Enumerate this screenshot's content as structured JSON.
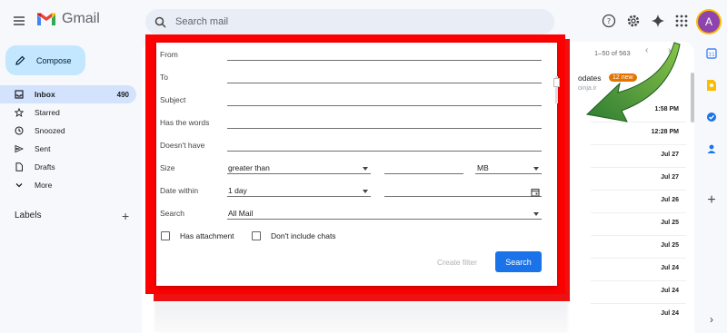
{
  "app": {
    "name": "Gmail"
  },
  "search": {
    "placeholder": "Search mail"
  },
  "sidebar": {
    "compose_label": "Compose",
    "items": [
      {
        "label": "Inbox",
        "count": "490",
        "icon": "inbox-icon"
      },
      {
        "label": "Starred",
        "icon": "star-icon"
      },
      {
        "label": "Snoozed",
        "icon": "clock-icon"
      },
      {
        "label": "Sent",
        "icon": "send-icon"
      },
      {
        "label": "Drafts",
        "icon": "draft-icon"
      },
      {
        "label": "More",
        "icon": "chevron-down-icon"
      }
    ],
    "labels_title": "Labels"
  },
  "header": {
    "avatar_letter": "A"
  },
  "list": {
    "pager": "1–50 of 563",
    "updates_title": "odates",
    "updates_badge": "12 new",
    "updates_sub": "oinja.ir",
    "dates": [
      "1:58 PM",
      "12:28 PM",
      "Jul 27",
      "Jul 27",
      "Jul 26",
      "Jul 25",
      "Jul 25",
      "Jul 24",
      "Jul 24",
      "Jul 24"
    ]
  },
  "filter": {
    "from_label": "From",
    "to_label": "To",
    "subject_label": "Subject",
    "has_words_label": "Has the words",
    "doesnt_have_label": "Doesn't have",
    "size_label": "Size",
    "size_operator": "greater than",
    "size_unit": "MB",
    "date_label": "Date within",
    "date_range": "1 day",
    "search_label": "Search",
    "search_scope": "All Mail",
    "has_attachment_label": "Has attachment",
    "exclude_chats_label": "Don't include chats",
    "create_filter_label": "Create filter",
    "search_button_label": "Search"
  },
  "colors": {
    "accent": "#1a73e8",
    "highlight_frame": "#ff0000",
    "arrow": "#4caf50",
    "compose": "#c2e7ff"
  }
}
